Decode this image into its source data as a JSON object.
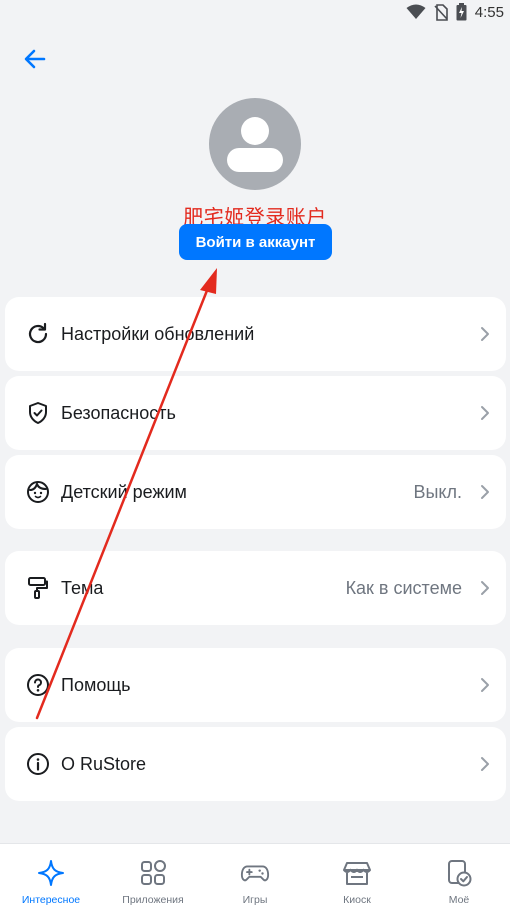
{
  "status_bar": {
    "time": "4:55",
    "icons": [
      "wifi-icon",
      "no-sim-icon",
      "battery-charging-icon"
    ]
  },
  "header": {
    "back_icon": "arrow-left-icon"
  },
  "profile": {
    "avatar_icon": "user-placeholder-icon",
    "annotation_text": "肥宅姬登录账户",
    "login_button_label": "Войти в аккаунт"
  },
  "menu": {
    "items": [
      {
        "label": "Настройки обновлений",
        "value": "",
        "icon": "refresh-icon"
      },
      {
        "label": "Безопасность",
        "value": "",
        "icon": "shield-check-icon"
      },
      {
        "label": "Детский режим",
        "value": "Выкл.",
        "icon": "child-face-icon"
      },
      {
        "label": "Тема",
        "value": "Как в системе",
        "icon": "paint-roller-icon"
      },
      {
        "label": "Помощь",
        "value": "",
        "icon": "help-circle-icon"
      },
      {
        "label": "О RuStore",
        "value": "",
        "icon": "info-circle-icon"
      }
    ]
  },
  "tabbar": {
    "tabs": [
      {
        "label": "Интересное",
        "icon": "sparkle-icon",
        "active": true
      },
      {
        "label": "Приложения",
        "icon": "apps-grid-icon",
        "active": false
      },
      {
        "label": "Игры",
        "icon": "gamepad-icon",
        "active": false
      },
      {
        "label": "Киоск",
        "icon": "kiosk-icon",
        "active": false
      },
      {
        "label": "Моё",
        "icon": "my-apps-icon",
        "active": false
      }
    ]
  },
  "colors": {
    "accent": "#0077ff",
    "background": "#f2f3f5",
    "annotation": "#e32a1e",
    "avatar_bg": "#a9adb3"
  }
}
